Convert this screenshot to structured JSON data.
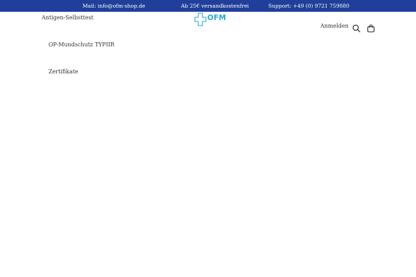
{
  "topbar": {
    "mail": "Mail: info@ofm-shop.de",
    "shipping": "Ab 25€ versandkostenfrei",
    "support": "Support: +49 (0) 9721 759880",
    "bg_color": "#1f3f9a"
  },
  "nav": {
    "left_link": "Antigen-Selbsttest",
    "login": "Anmelden"
  },
  "logo": {
    "text": "OFM",
    "color": "#27a9d6",
    "icon": "cross-icon"
  },
  "icons": {
    "search": "search-icon",
    "cart": "cart-icon"
  },
  "menu": {
    "items": [
      "OP-Mundschutz TYPIIR",
      "Zertifikate"
    ]
  }
}
